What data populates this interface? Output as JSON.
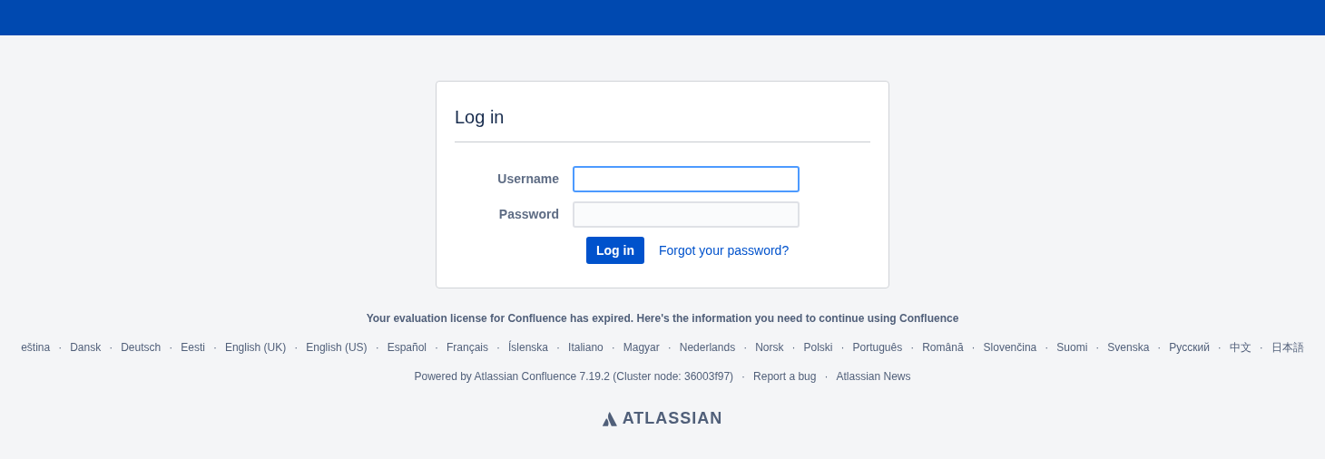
{
  "login": {
    "title": "Log in",
    "fields": [
      {
        "label": "Username",
        "focused": true
      },
      {
        "label": "Password",
        "focused": false
      }
    ],
    "submit": "Log in",
    "forgot_link": "Forgot your password?"
  },
  "footer": {
    "license_notice": "Your evaluation license for Confluence has expired. Here's the information you need to continue using Confluence",
    "separator": "·",
    "languages": [
      "eština",
      "Dansk",
      "Deutsch",
      "Eesti",
      "English (UK)",
      "English (US)",
      "Español",
      "Français",
      "Íslenska",
      "Italiano",
      "Magyar",
      "Nederlands",
      "Norsk",
      "Polski",
      "Português",
      "Română",
      "Slovenčina",
      "Suomi",
      "Svenska",
      "Русский",
      "中文",
      "日本語"
    ],
    "powered_by": "Powered by Atlassian Confluence 7.19.2 (Cluster node: 36003f97)",
    "links": [
      "Report a bug",
      "Atlassian News"
    ],
    "logo_text": "ATLASSIAN"
  }
}
